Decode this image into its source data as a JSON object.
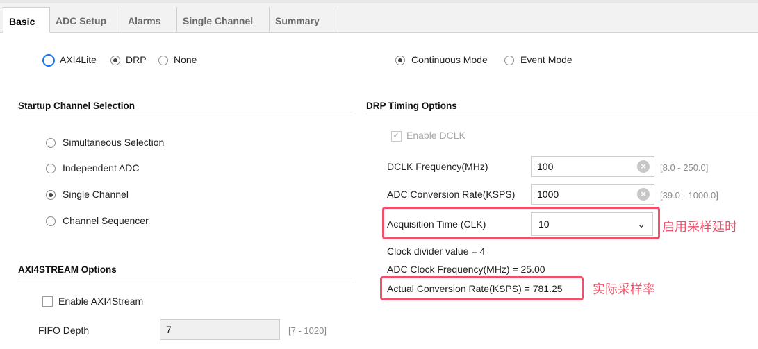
{
  "tabs": [
    "Basic",
    "ADC Setup",
    "Alarms",
    "Single Channel",
    "Summary"
  ],
  "interface": {
    "options": [
      "AXI4Lite",
      "DRP",
      "None"
    ],
    "selected": "DRP"
  },
  "mode": {
    "options": [
      "Continuous Mode",
      "Event Mode"
    ],
    "selected": "Continuous Mode"
  },
  "startup": {
    "title": "Startup Channel Selection",
    "options": [
      "Simultaneous Selection",
      "Independent ADC",
      "Single Channel",
      "Channel Sequencer"
    ],
    "selected": "Single Channel"
  },
  "drp": {
    "title": "DRP Timing Options",
    "enable_dclk": "Enable DCLK",
    "dclk_label": "DCLK Frequency(MHz)",
    "dclk_value": "100",
    "dclk_range": "[8.0 - 250.0]",
    "rate_label": "ADC Conversion Rate(KSPS)",
    "rate_value": "1000",
    "rate_range": "[39.0 - 1000.0]",
    "acq_label": "Acquisition Time (CLK)",
    "acq_value": "10",
    "divider": "Clock divider value = 4",
    "adc_clock": "ADC Clock Frequency(MHz) = 25.00",
    "actual_rate": "Actual Conversion Rate(KSPS) = 781.25"
  },
  "annotations": {
    "acq_note": "启用采样延时",
    "rate_note": "实际采样率",
    "color": "#f0516a"
  },
  "axi4stream": {
    "title": "AXI4STREAM Options",
    "enable_label": "Enable AXI4Stream",
    "fifo_label": "FIFO Depth",
    "fifo_value": "7",
    "fifo_range": "[7 - 1020]"
  },
  "icons": {
    "clear": "clear-x-icon",
    "dropdown": "chevron-down-icon",
    "check": "check-icon"
  }
}
